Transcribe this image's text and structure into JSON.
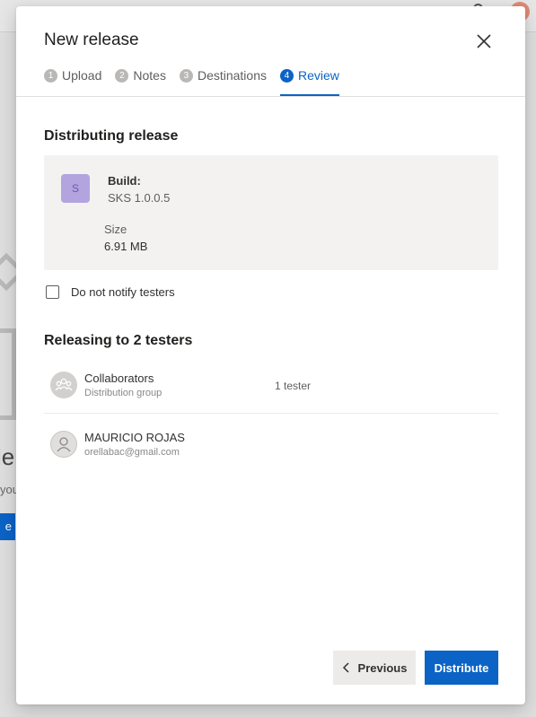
{
  "background": {
    "heading_fragment": "le",
    "text_fragment": "you",
    "button_fragment": "e"
  },
  "modal": {
    "title": "New release",
    "steps": [
      {
        "number": "1",
        "label": "Upload"
      },
      {
        "number": "2",
        "label": "Notes"
      },
      {
        "number": "3",
        "label": "Destinations"
      },
      {
        "number": "4",
        "label": "Review",
        "active": true
      }
    ],
    "distributing": {
      "title": "Distributing release",
      "app_initial": "S",
      "build_label": "Build:",
      "build_value": "SKS 1.0.0.5",
      "size_label": "Size",
      "size_value": "6.91 MB"
    },
    "notify_checkbox": {
      "label": "Do not notify testers",
      "checked": false
    },
    "releasing": {
      "title": "Releasing to 2 testers",
      "testers": [
        {
          "name": "Collaborators",
          "sub": "Distribution group",
          "count": "1 tester",
          "icon": "group-icon"
        },
        {
          "name": "MAURICIO ROJAS",
          "sub": "orellabac@gmail.com",
          "count": "",
          "icon": "person-icon"
        }
      ]
    },
    "buttons": {
      "previous": "Previous",
      "distribute": "Distribute"
    }
  },
  "colors": {
    "accent": "#0b63c5",
    "card_bg": "#f3f2f1",
    "app_icon_bg": "#b3a4e0"
  }
}
